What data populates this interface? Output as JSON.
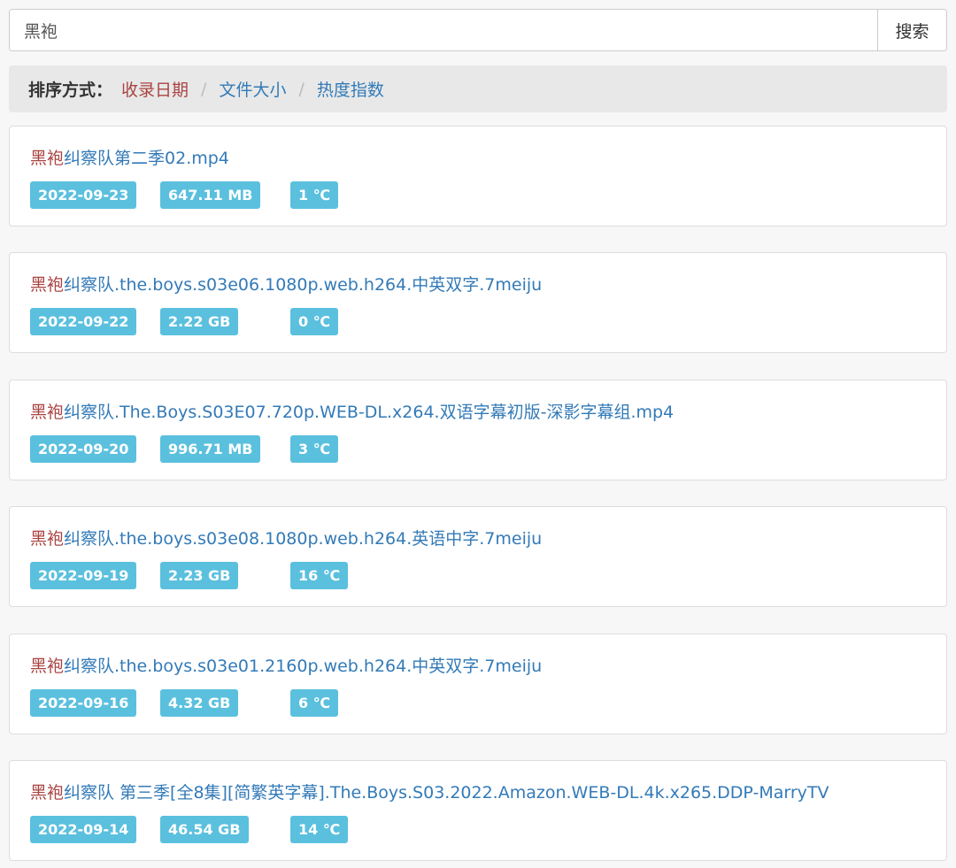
{
  "search": {
    "value": "黑袍",
    "button_label": "搜索"
  },
  "sort": {
    "label": "排序方式：",
    "options": [
      "收录日期",
      "文件大小",
      "热度指数"
    ],
    "separator": "/",
    "active_index": 0
  },
  "results": [
    {
      "highlight": "黑袍",
      "rest": "纠察队第二季02.mp4",
      "date": "2022-09-23",
      "size": "647.11 MB",
      "heat": "1 ℃"
    },
    {
      "highlight": "黑袍",
      "rest": "纠察队.the.boys.s03e06.1080p.web.h264.中英双字.7meiju",
      "date": "2022-09-22",
      "size": "2.22 GB",
      "heat": "0 ℃"
    },
    {
      "highlight": "黑袍",
      "rest": "纠察队.The.Boys.S03E07.720p.WEB-DL.x264.双语字幕初版-深影字幕组.mp4",
      "date": "2022-09-20",
      "size": "996.71 MB",
      "heat": "3 ℃"
    },
    {
      "highlight": "黑袍",
      "rest": "纠察队.the.boys.s03e08.1080p.web.h264.英语中字.7meiju",
      "date": "2022-09-19",
      "size": "2.23 GB",
      "heat": "16 ℃"
    },
    {
      "highlight": "黑袍",
      "rest": "纠察队.the.boys.s03e01.2160p.web.h264.中英双字.7meiju",
      "date": "2022-09-16",
      "size": "4.32 GB",
      "heat": "6 ℃"
    },
    {
      "highlight": "黑袍",
      "rest": "纠察队 第三季[全8集][简繁英字幕].The.Boys.S03.2022.Amazon.WEB-DL.4k.x265.DDP-MarryTV",
      "date": "2022-09-14",
      "size": "46.54 GB",
      "heat": "14 ℃"
    }
  ],
  "colors": {
    "link": "#337ab7",
    "highlight": "#a94442",
    "badge": "#5bc0de",
    "sortbar": "#e8e8e8"
  }
}
